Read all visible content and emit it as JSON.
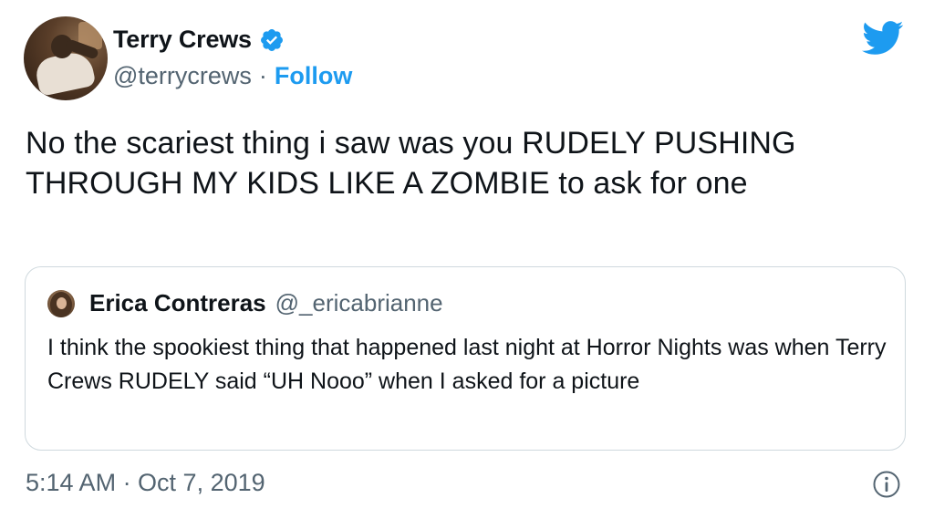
{
  "author": {
    "display_name": "Terry Crews",
    "handle": "@terrycrews",
    "separator": "·",
    "follow_label": "Follow",
    "verified": true
  },
  "tweet": {
    "text": "No the scariest thing i saw was you RUDELY PUSHING THROUGH MY KIDS LIKE A ZOMBIE to ask for one"
  },
  "quoted_tweet": {
    "display_name": "Erica Contreras",
    "handle": "@_ericabrianne",
    "text": "I think the spookiest thing that happened last night at Horror Nights was when Terry Crews RUDELY said “UH Nooo” when I asked for a picture"
  },
  "footer": {
    "timestamp": "5:14 AM · Oct 7, 2019"
  },
  "icons": {
    "verified": "verified-badge-icon",
    "brand": "twitter-bird-icon",
    "info": "info-icon"
  },
  "colors": {
    "accent": "#1d9bf0",
    "text": "#0f1419",
    "secondary": "#536471",
    "border": "#cfd9de"
  }
}
